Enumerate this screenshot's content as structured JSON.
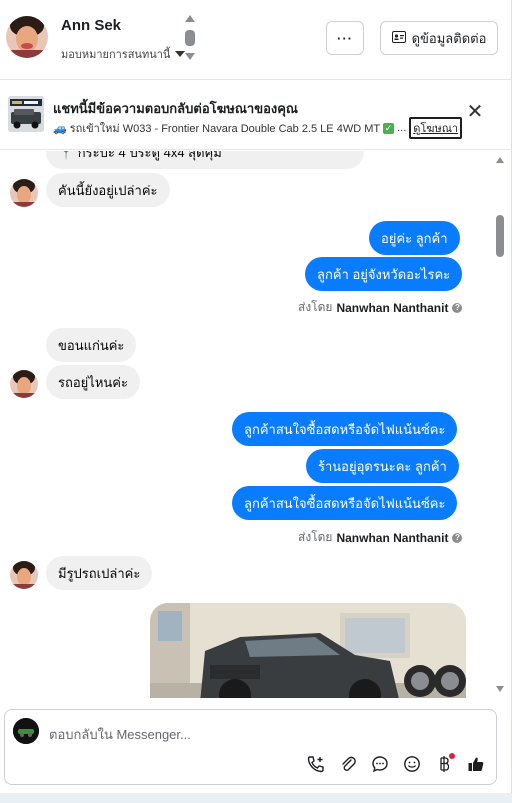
{
  "header": {
    "contact_name": "Ann Sek",
    "assign_label": "มอบหมายการสนทนานี้",
    "more_label": "···",
    "contact_info_label": "ดูข้อมูลติดต่อ"
  },
  "ad_banner": {
    "title": "แชทนี้มีข้อความตอบกลับต่อโฆษณาของคุณ",
    "subtitle": "🚙 รถเข้าใหม่ W033 - Frontier Navara Double Cab 2.5 LE 4WD MT",
    "ellipsis": "...",
    "view_ad_label": "ดูโฆษณา",
    "close_label": "✕"
  },
  "messages": {
    "m0": "📍 กระบะ 4 ประตู 4x4 สุดคุ้ม",
    "m1": "คันนี้ยังอยู่เปล่าค่ะ",
    "m2": "อยู่ค่ะ  ลูกค้า",
    "m3": "ลูกค้า อยู่จังหวัดอะไรคะ",
    "m4": "ขอนแก่นค่ะ",
    "m5": "รถอยู่ไหนค่ะ",
    "m6": "ลูกค้าสนใจซื้อสดหรือจัดไฟแน้นซ์คะ",
    "m7": "ร้านอยู่อุดรนะคะ   ลูกค้า",
    "m8": "ลูกค้าสนใจซื้อสดหรือจัดไฟแน้นซ์คะ",
    "m9": "มีรูปรถเปล่าค่ะ"
  },
  "sent_by": {
    "prefix": "ส่งโดย",
    "name": "Nanwhan Nanthanit"
  },
  "composer": {
    "placeholder": "ตอบกลับใน Messenger..."
  },
  "colors": {
    "outgoing": "#0a7cff",
    "incoming": "#f0f0f0",
    "notification": "#e41e3f"
  }
}
